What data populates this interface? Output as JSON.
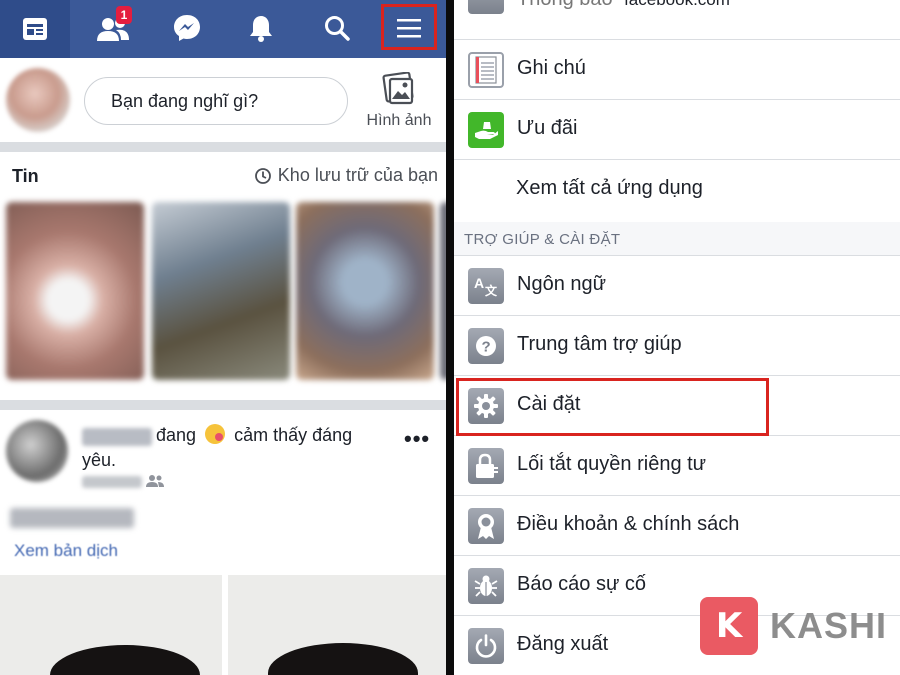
{
  "left": {
    "nav": {
      "friend_badge": "1",
      "icons": [
        "feed-icon",
        "friends-icon",
        "messenger-icon",
        "bell-icon",
        "search-icon",
        "menu-icon"
      ]
    },
    "composer": {
      "placeholder": "Bạn đang nghĩ gì?",
      "photo_label": "Hình ảnh"
    },
    "stories": {
      "title": "Tin",
      "archive_label": "Kho lưu trữ của bạn"
    },
    "post": {
      "text_part1": "đang",
      "text_part2": "cảm thấy đáng",
      "text_line2": "yêu.",
      "more": "•••",
      "translation_link": "Xem bản dịch"
    }
  },
  "right": {
    "url": "facebook.com",
    "partial_item": "Thông báo",
    "items_top": [
      {
        "label": "Ghi chú",
        "icon": "notes-icon"
      },
      {
        "label": "Ưu đãi",
        "icon": "offers-icon"
      },
      {
        "label": "Xem tất cả ứng dụng",
        "icon": ""
      }
    ],
    "section_title": "TRỢ GIÚP & CÀI ĐẶT",
    "items_help": [
      {
        "label": "Ngôn ngữ",
        "icon": "language-icon"
      },
      {
        "label": "Trung tâm trợ giúp",
        "icon": "help-icon"
      },
      {
        "label": "Cài đặt",
        "icon": "gear-icon"
      },
      {
        "label": "Lối tắt quyền riêng tư",
        "icon": "privacy-lock-icon"
      },
      {
        "label": "Điều khoản & chính sách",
        "icon": "terms-badge-icon"
      },
      {
        "label": "Báo cáo sự cố",
        "icon": "bug-icon"
      },
      {
        "label": "Đăng xuất",
        "icon": "power-icon"
      }
    ]
  },
  "watermark": {
    "letter": "K",
    "text": "KASHI"
  },
  "colors": {
    "facebook_blue": "#3b5998",
    "highlight_red": "#d9241f",
    "badge_red": "#e41e3f",
    "offer_green": "#42b72a"
  }
}
